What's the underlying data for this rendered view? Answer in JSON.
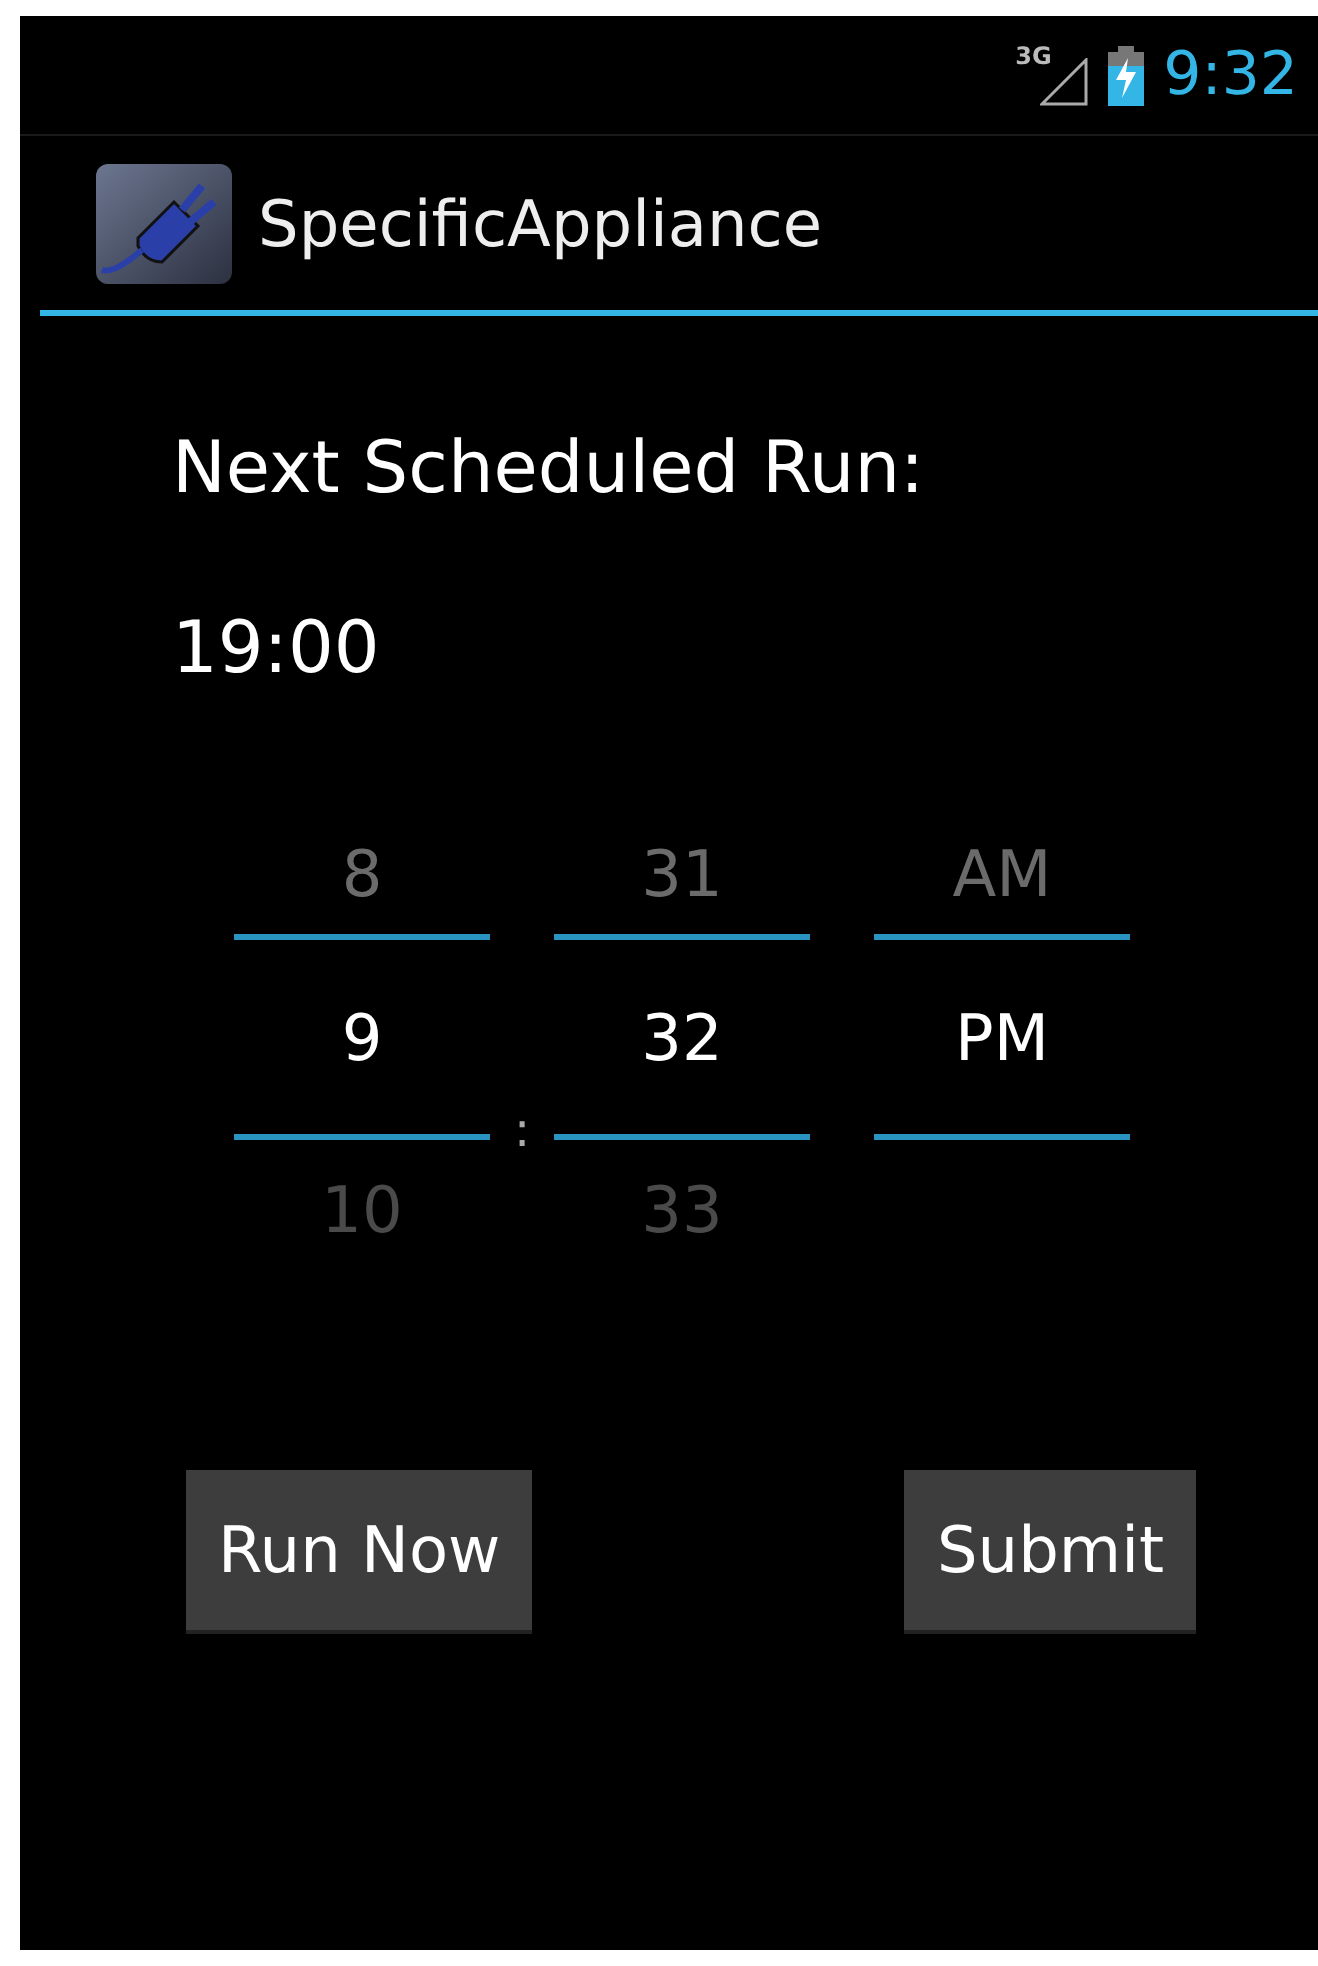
{
  "status_bar": {
    "network": "3G",
    "time": "9:32"
  },
  "action_bar": {
    "title": "SpecificAppliance"
  },
  "heading": "Next Scheduled Run:",
  "scheduled_time": "19:00",
  "time_picker": {
    "separator": ":",
    "columns": [
      {
        "above": "8",
        "value": "9",
        "below": "10"
      },
      {
        "above": "31",
        "value": "32",
        "below": "33"
      },
      {
        "above": "AM",
        "value": "PM"
      }
    ]
  },
  "buttons": [
    "Run Now",
    "Submit"
  ]
}
